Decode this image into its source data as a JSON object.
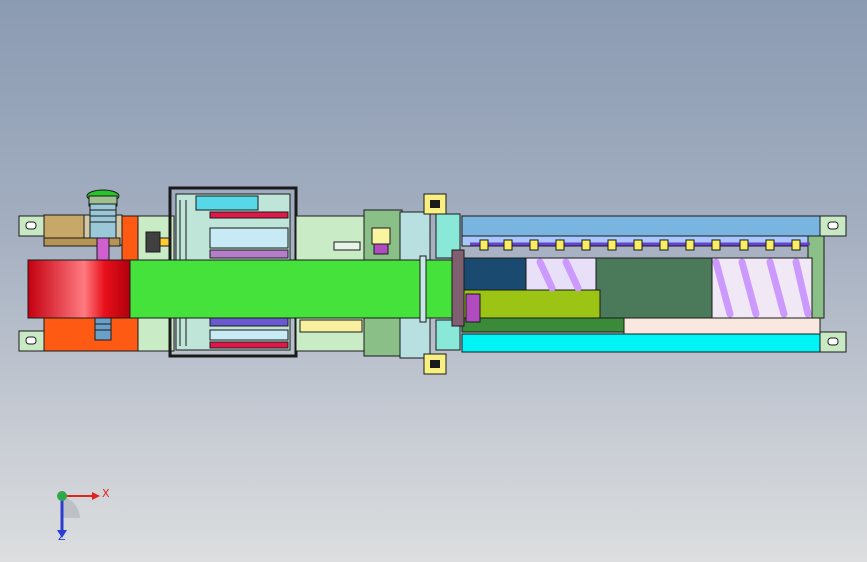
{
  "viewport": {
    "name": "cad-3d-viewport",
    "background_top": "#8b9bb2",
    "background_bottom": "#dcdedf"
  },
  "model": {
    "colors": {
      "red_roller": "#e8101a",
      "green_belt": "#46e23c",
      "cyan_rail": "#00f4f6",
      "blue_rail": "#7ab4e0",
      "orange_plate": "#ff5a14",
      "khaki_block": "#c8a868",
      "navy_box": "#1a4a70",
      "olive_plate": "#9cc414",
      "dark_green_box": "#4a7a5a",
      "violet_rod": "#cc99ff",
      "frame_line": "#1a1a1a"
    }
  },
  "triad": {
    "x_label": "X",
    "z_label": "Z",
    "x_color": "#e0251c",
    "y_color": "#2ea84a",
    "z_color": "#2a3fd0"
  }
}
